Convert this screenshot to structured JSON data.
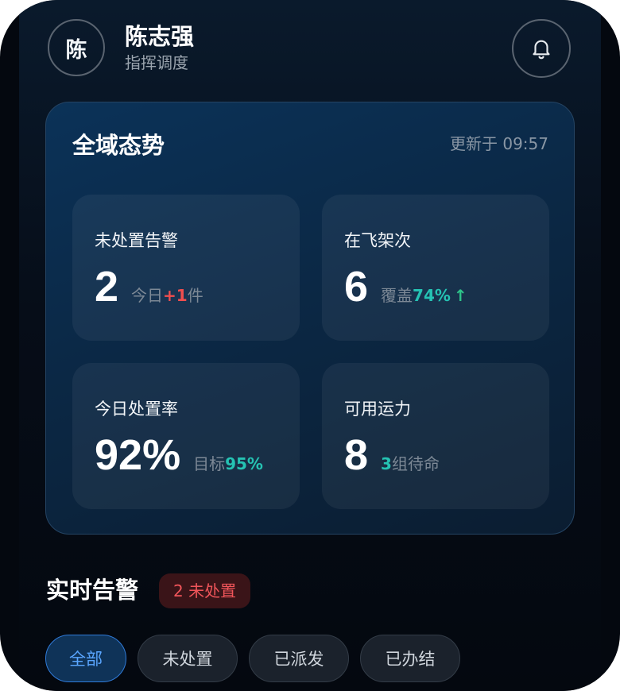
{
  "header": {
    "avatar_char": "陈",
    "user_name": "陈志强",
    "user_role": "指挥调度",
    "bell_icon": "bell-icon"
  },
  "overview": {
    "title": "全域态势",
    "updated": "更新于 09:57",
    "stats": [
      {
        "label": "未处置告警",
        "value": "2",
        "note_prefix": "今日",
        "note_highlight": "+1",
        "note_suffix": "件"
      },
      {
        "label": "在飞架次",
        "value": "6",
        "note_prefix": "覆盖",
        "note_highlight": "74%",
        "note_arrow": "↑"
      },
      {
        "label": "今日处置率",
        "value": "92%",
        "note_prefix": "目标",
        "note_highlight": "95%"
      },
      {
        "label": "可用运力",
        "value": "8",
        "note_highlight": "3",
        "note_suffix": "组待命"
      }
    ]
  },
  "alerts": {
    "title": "实时告警",
    "badge": "2 未处置",
    "filters": [
      "全部",
      "未处置",
      "已派发",
      "已办结"
    ],
    "active_filter": "全部"
  },
  "colors": {
    "accent_blue": "#2f7ad8",
    "alert_red": "#ef4e4e",
    "teal": "#25c3b3",
    "up_green": "#2ec48a"
  }
}
